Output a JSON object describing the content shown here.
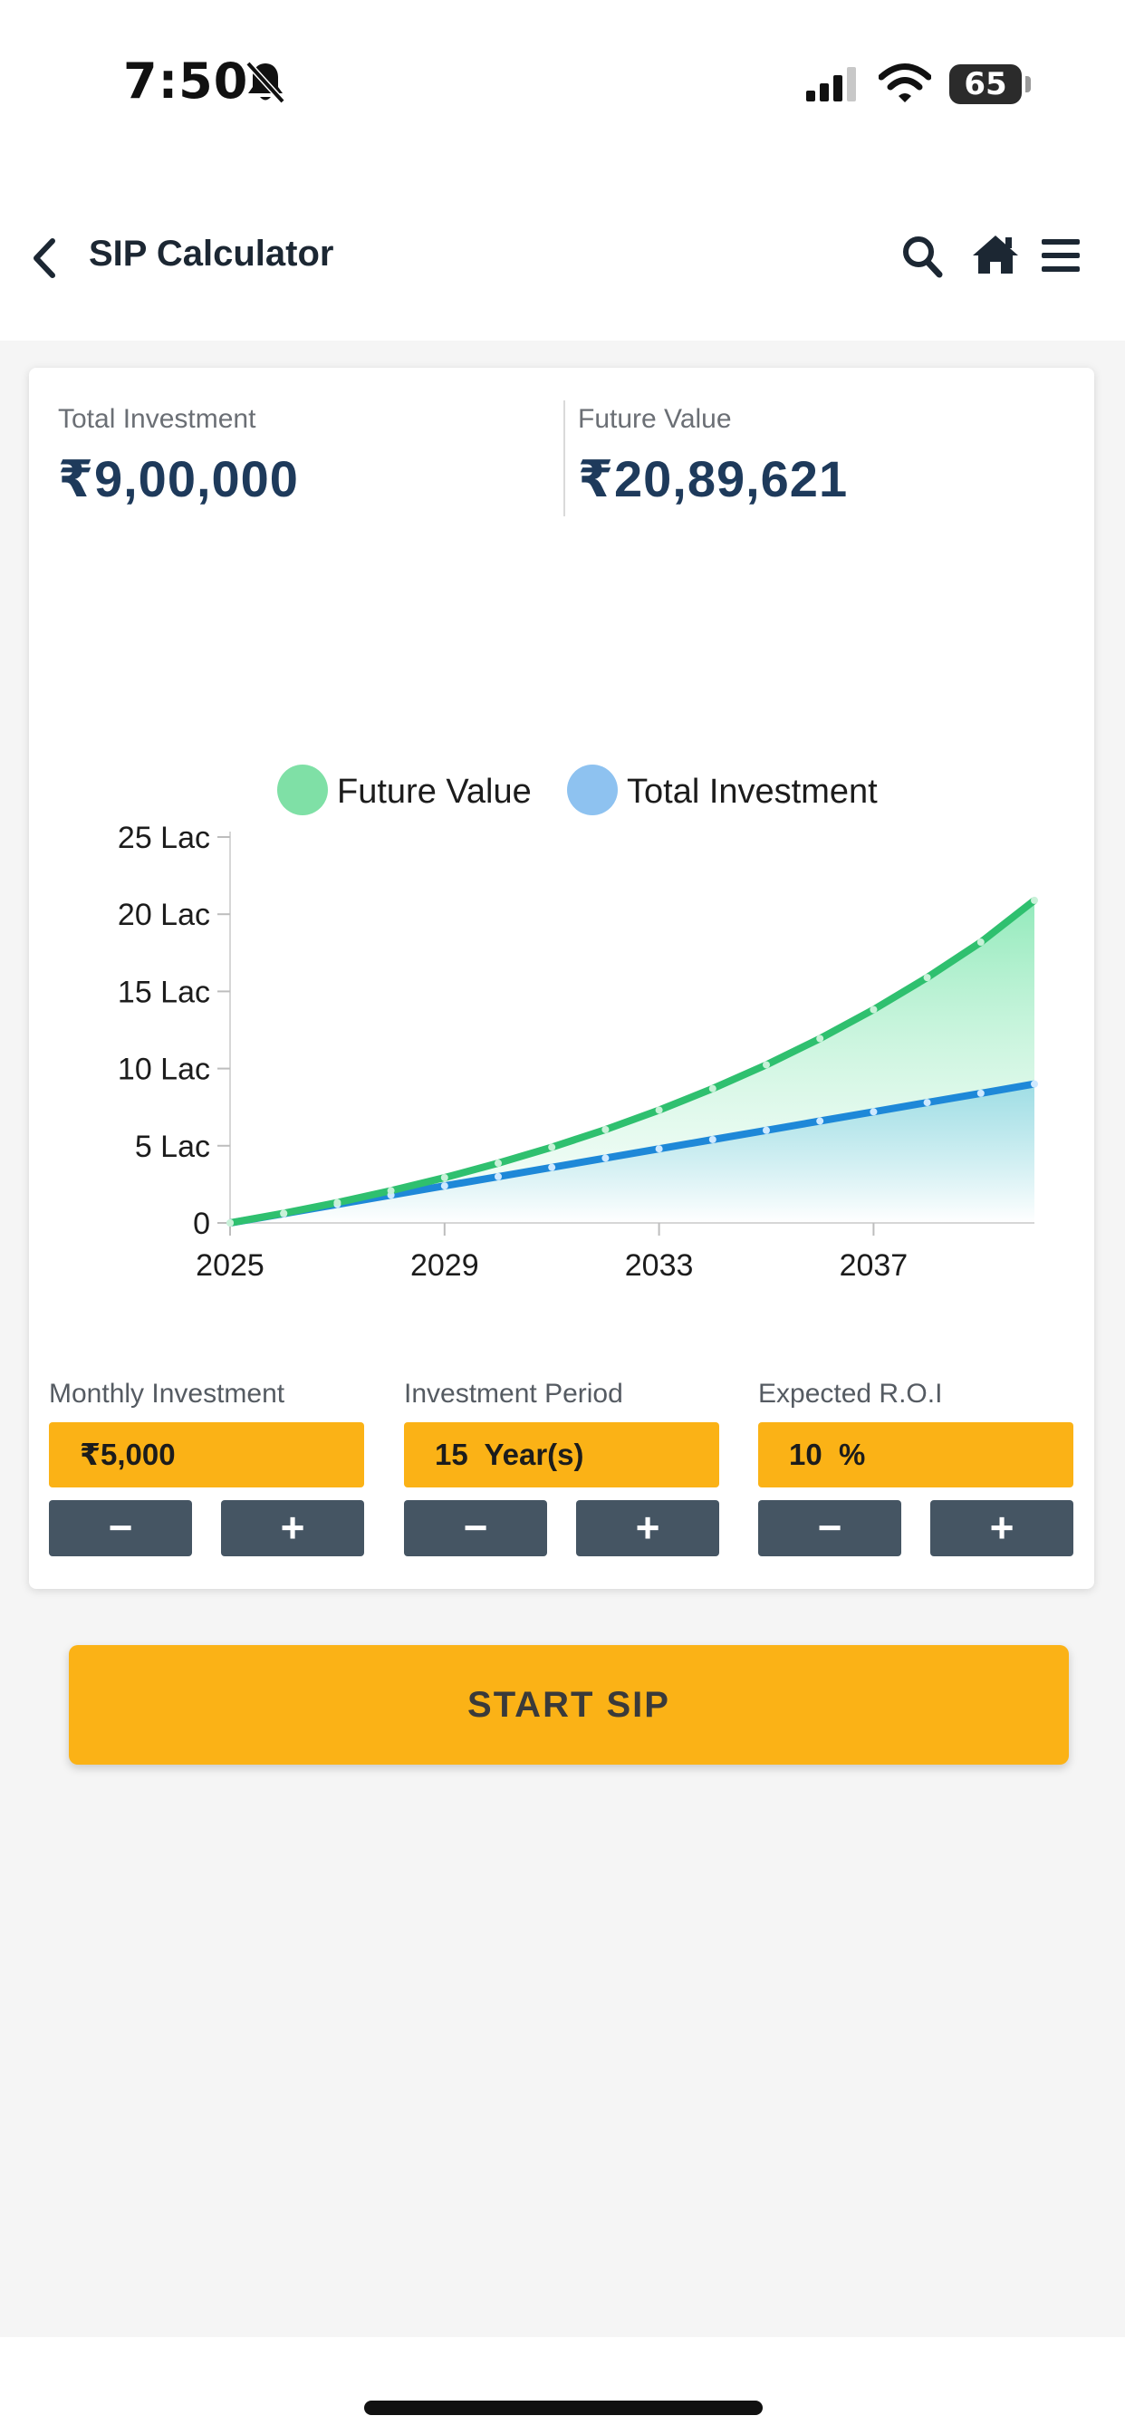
{
  "status_bar": {
    "time": "7:50",
    "battery": "65",
    "icons": [
      "bell-slash-icon",
      "signal-icon",
      "wifi-icon",
      "battery-icon"
    ]
  },
  "header": {
    "title": "SIP Calculator",
    "icons": [
      "back-icon",
      "search-icon",
      "home-icon",
      "menu-icon"
    ]
  },
  "summary": {
    "total_investment_label": "Total Investment",
    "total_investment_value": "₹9,00,000",
    "future_value_label": "Future Value",
    "future_value_value": "₹20,89,621"
  },
  "chart_data": {
    "type": "area",
    "legend": [
      "Future Value",
      "Total Investment"
    ],
    "legend_position": "top",
    "x": [
      2025,
      2026,
      2027,
      2028,
      2029,
      2030,
      2031,
      2032,
      2033,
      2034,
      2035,
      2036,
      2037,
      2038,
      2039,
      2040
    ],
    "xticks": [
      "2025",
      "2029",
      "2033",
      "2037"
    ],
    "yticks": [
      "0",
      "5 Lac",
      "10 Lac",
      "15 Lac",
      "20 Lac",
      "25 Lac"
    ],
    "ylim": [
      0,
      2500000
    ],
    "series": [
      {
        "name": "Future Value",
        "color": "#2fc06f",
        "values": [
          0,
          62827,
          132232,
          208904,
          293604,
          387174,
          490543,
          604733,
          730880,
          870234,
          1024180,
          1194244,
          1382114,
          1589653,
          1818923,
          2089621
        ]
      },
      {
        "name": "Total Investment",
        "color": "#1e88d8",
        "values": [
          0,
          60000,
          120000,
          180000,
          240000,
          300000,
          360000,
          420000,
          480000,
          540000,
          600000,
          660000,
          720000,
          780000,
          840000,
          900000
        ]
      }
    ],
    "grid": false
  },
  "controls": [
    {
      "label": "Monthly Investment",
      "value": "₹5,000",
      "minus": "−",
      "plus": "+"
    },
    {
      "label": "Investment Period",
      "value": "15  Year(s)",
      "minus": "−",
      "plus": "+"
    },
    {
      "label": "Expected R.O.I",
      "value": "10  %",
      "minus": "−",
      "plus": "+"
    }
  ],
  "cta": {
    "label": "START SIP",
    "color": "#fbb216"
  }
}
